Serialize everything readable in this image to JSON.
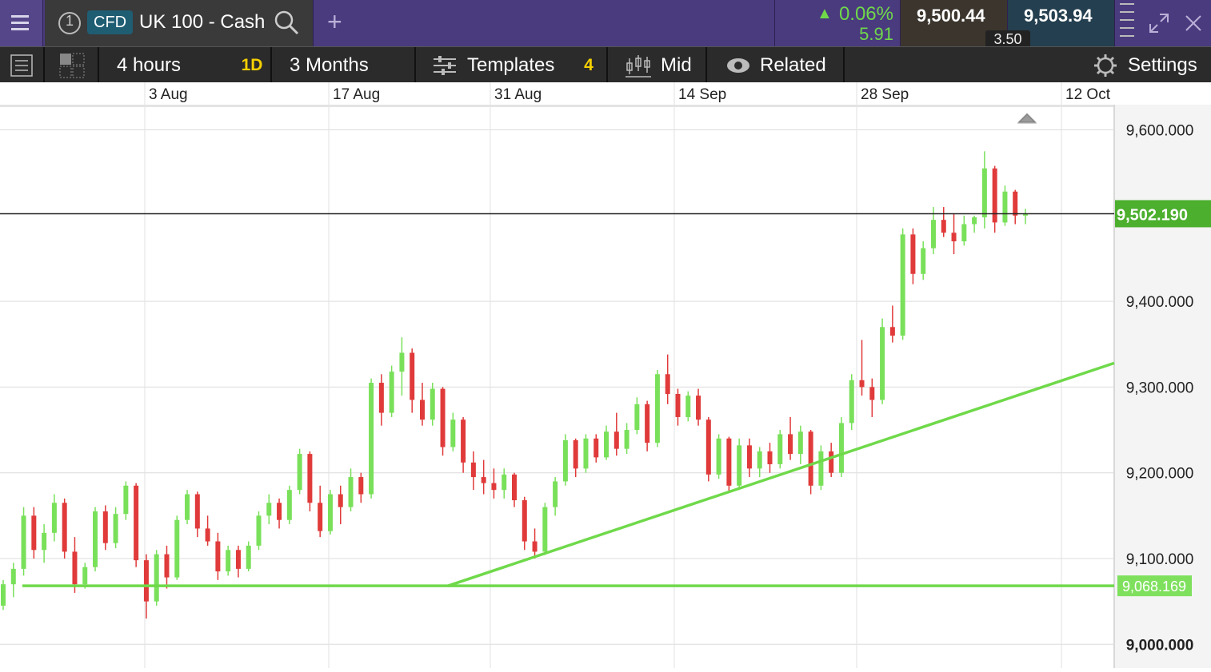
{
  "header": {
    "menu_icon": "hamburger-icon",
    "tab_number": "1",
    "instrument_type": "CFD",
    "instrument_name": "UK 100 - Cash",
    "change_percent": "0.06%",
    "change_points": "5.91",
    "sell_price": "9,500.44",
    "buy_price": "9,503.94",
    "spread": "3.50",
    "add_tab_label": "+"
  },
  "toolbar": {
    "interval": "4 hours",
    "interval_badge": "1D",
    "range": "3 Months",
    "templates_label": "Templates",
    "templates_badge": "4",
    "price_type": "Mid",
    "related_label": "Related",
    "settings_label": "Settings"
  },
  "colors": {
    "up": "#79e05a",
    "down": "#e03a3a",
    "accent_green": "#6fd94a",
    "header_bg": "#4a3a7e"
  },
  "chart_data": {
    "type": "candlestick",
    "x_tick_labels": [
      "3 Aug",
      "17 Aug",
      "31 Aug",
      "14 Sep",
      "28 Sep",
      "12 Oct"
    ],
    "y_tick_labels": [
      "9,600.000",
      "9,400.000",
      "9,300.000",
      "9,200.000",
      "9,100.000",
      "9,000.000"
    ],
    "y_ticks": [
      9600,
      9400,
      9300,
      9200,
      9100,
      9000
    ],
    "ylim": [
      8970,
      9630
    ],
    "current_price_label": "9,502.190",
    "current_price": 9502.19,
    "horizontal_level_label": "9,068.169",
    "horizontal_level": 9068.169,
    "trendline": {
      "start": [
        "~27 Aug",
        9068
      ],
      "end": [
        "~12 Oct",
        9328
      ]
    },
    "series": [
      {
        "values": [
          [
            9045,
            9075,
            9040,
            9070
          ],
          [
            9070,
            9095,
            9055,
            9088
          ],
          [
            9088,
            9160,
            9080,
            9150
          ],
          [
            9150,
            9160,
            9100,
            9110
          ],
          [
            9110,
            9140,
            9095,
            9130
          ],
          [
            9130,
            9175,
            9120,
            9165
          ],
          [
            9165,
            9170,
            9100,
            9108
          ],
          [
            9108,
            9125,
            9060,
            9070
          ],
          [
            9070,
            9095,
            9065,
            9090
          ],
          [
            9090,
            9160,
            9085,
            9155
          ],
          [
            9155,
            9162,
            9110,
            9118
          ],
          [
            9118,
            9160,
            9112,
            9152
          ],
          [
            9152,
            9190,
            9145,
            9185
          ],
          [
            9185,
            9188,
            9090,
            9098
          ],
          [
            9098,
            9105,
            9030,
            9050
          ],
          [
            9050,
            9110,
            9045,
            9105
          ],
          [
            9105,
            9115,
            9065,
            9078
          ],
          [
            9078,
            9150,
            9075,
            9145
          ],
          [
            9145,
            9180,
            9140,
            9175
          ],
          [
            9175,
            9178,
            9125,
            9135
          ],
          [
            9135,
            9150,
            9115,
            9120
          ],
          [
            9120,
            9130,
            9075,
            9085
          ],
          [
            9085,
            9115,
            9080,
            9110
          ],
          [
            9110,
            9115,
            9078,
            9088
          ],
          [
            9088,
            9120,
            9085,
            9115
          ],
          [
            9115,
            9155,
            9110,
            9150
          ],
          [
            9150,
            9175,
            9140,
            9165
          ],
          [
            9165,
            9170,
            9135,
            9145
          ],
          [
            9145,
            9185,
            9140,
            9180
          ],
          [
            9180,
            9228,
            9175,
            9222
          ],
          [
            9222,
            9225,
            9155,
            9165
          ],
          [
            9165,
            9185,
            9125,
            9132
          ],
          [
            9132,
            9180,
            9128,
            9175
          ],
          [
            9175,
            9185,
            9140,
            9160
          ],
          [
            9160,
            9205,
            9155,
            9195
          ],
          [
            9195,
            9200,
            9165,
            9175
          ],
          [
            9175,
            9310,
            9170,
            9305
          ],
          [
            9305,
            9315,
            9255,
            9270
          ],
          [
            9270,
            9325,
            9265,
            9318
          ],
          [
            9318,
            9358,
            9290,
            9340
          ],
          [
            9340,
            9345,
            9270,
            9285
          ],
          [
            9285,
            9305,
            9255,
            9262
          ],
          [
            9262,
            9305,
            9255,
            9298
          ],
          [
            9298,
            9300,
            9220,
            9230
          ],
          [
            9230,
            9270,
            9225,
            9262
          ],
          [
            9262,
            9265,
            9200,
            9212
          ],
          [
            9212,
            9225,
            9180,
            9195
          ],
          [
            9195,
            9215,
            9175,
            9188
          ],
          [
            9188,
            9205,
            9170,
            9180
          ],
          [
            9180,
            9205,
            9170,
            9198
          ],
          [
            9198,
            9200,
            9160,
            9168
          ],
          [
            9168,
            9172,
            9110,
            9120
          ],
          [
            9120,
            9135,
            9100,
            9108
          ],
          [
            9108,
            9165,
            9104,
            9160
          ],
          [
            9160,
            9195,
            9150,
            9190
          ],
          [
            9190,
            9245,
            9185,
            9238
          ],
          [
            9238,
            9240,
            9195,
            9205
          ],
          [
            9205,
            9245,
            9200,
            9240
          ],
          [
            9240,
            9245,
            9212,
            9218
          ],
          [
            9218,
            9255,
            9215,
            9248
          ],
          [
            9248,
            9270,
            9220,
            9228
          ],
          [
            9228,
            9258,
            9222,
            9250
          ],
          [
            9250,
            9288,
            9245,
            9280
          ],
          [
            9280,
            9284,
            9225,
            9235
          ],
          [
            9235,
            9320,
            9230,
            9315
          ],
          [
            9315,
            9338,
            9280,
            9292
          ],
          [
            9292,
            9298,
            9255,
            9265
          ],
          [
            9265,
            9295,
            9260,
            9290
          ],
          [
            9290,
            9298,
            9255,
            9262
          ],
          [
            9262,
            9265,
            9190,
            9198
          ],
          [
            9198,
            9245,
            9193,
            9240
          ],
          [
            9240,
            9242,
            9178,
            9185
          ],
          [
            9185,
            9240,
            9180,
            9232
          ],
          [
            9232,
            9240,
            9195,
            9205
          ],
          [
            9205,
            9230,
            9195,
            9225
          ],
          [
            9225,
            9235,
            9200,
            9210
          ],
          [
            9210,
            9250,
            9205,
            9245
          ],
          [
            9245,
            9265,
            9215,
            9222
          ],
          [
            9222,
            9255,
            9210,
            9248
          ],
          [
            9248,
            9250,
            9175,
            9185
          ],
          [
            9185,
            9232,
            9180,
            9225
          ],
          [
            9225,
            9235,
            9195,
            9200
          ],
          [
            9200,
            9265,
            9195,
            9258
          ],
          [
            9258,
            9315,
            9250,
            9308
          ],
          [
            9308,
            9355,
            9290,
            9300
          ],
          [
            9300,
            9310,
            9265,
            9285
          ],
          [
            9285,
            9380,
            9280,
            9370
          ],
          [
            9370,
            9395,
            9352,
            9360
          ],
          [
            9360,
            9485,
            9355,
            9478
          ],
          [
            9478,
            9485,
            9420,
            9432
          ],
          [
            9432,
            9470,
            9425,
            9462
          ],
          [
            9462,
            9510,
            9455,
            9495
          ],
          [
            9495,
            9510,
            9475,
            9480
          ],
          [
            9480,
            9502,
            9455,
            9470
          ],
          [
            9470,
            9500,
            9465,
            9490
          ],
          [
            9490,
            9500,
            9480,
            9498
          ],
          [
            9498,
            9575,
            9485,
            9555
          ],
          [
            9555,
            9558,
            9480,
            9492
          ],
          [
            9492,
            9535,
            9488,
            9528
          ],
          [
            9528,
            9530,
            9490,
            9500
          ],
          [
            9500,
            9508,
            9490,
            9502
          ]
        ]
      }
    ]
  }
}
